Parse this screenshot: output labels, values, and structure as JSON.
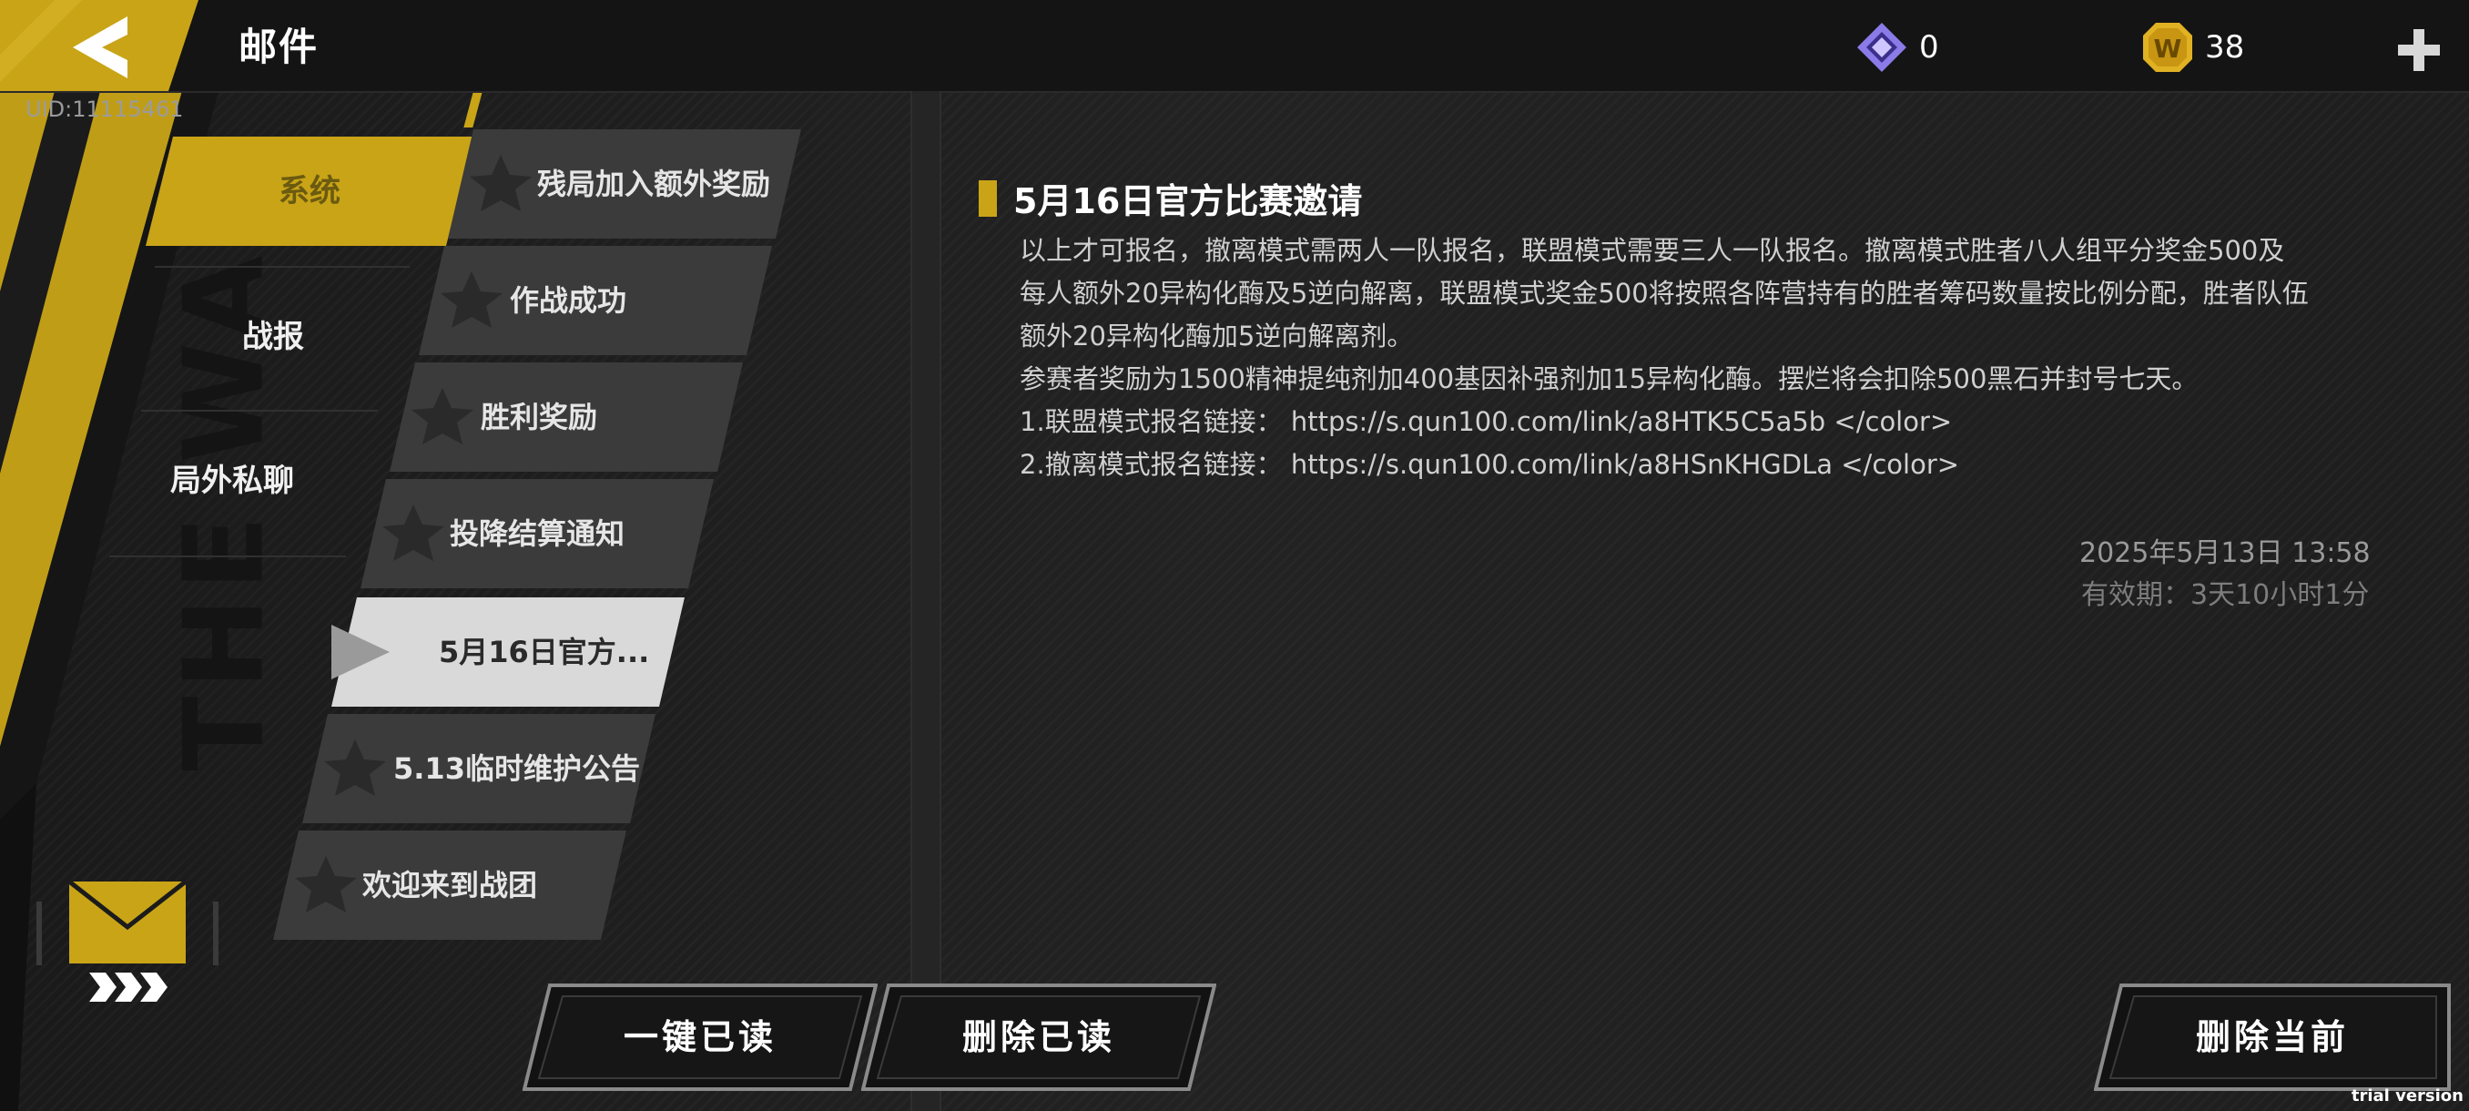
{
  "header": {
    "title": "邮件",
    "uid": "UID:11115461",
    "gem_count": "0",
    "coin_count": "38",
    "coin_letter": "W"
  },
  "deco": {
    "vertical_text": "THE WAR"
  },
  "categories": [
    {
      "label": "系统",
      "active": true
    },
    {
      "label": "战报",
      "active": false
    },
    {
      "label": "局外私聊",
      "active": false
    }
  ],
  "mail_list": [
    {
      "label": "残局加入额外奖励"
    },
    {
      "label": "作战成功"
    },
    {
      "label": "胜利奖励"
    },
    {
      "label": "投降结算通知"
    },
    {
      "label": "5月16日官方..."
    },
    {
      "label": "5.13临时维护公告"
    },
    {
      "label": "欢迎来到战团"
    }
  ],
  "mail": {
    "title": "5月16日官方比赛邀请",
    "body": [
      "以上才可报名，撤离模式需两人一队报名，联盟模式需要三人一队报名。撤离模式胜者八人组平分奖金500及",
      "每人额外20异构化酶及5逆向解离，联盟模式奖金500将按照各阵营持有的胜者筹码数量按比例分配，胜者队伍",
      "额外20异构化酶加5逆向解离剂。",
      "参赛者奖励为1500精神提纯剂加400基因补强剂加15异构化酶。摆烂将会扣除500黑石并封号七天。",
      "1.联盟模式报名链接：  https://s.qun100.com/link/a8HTK5C5a5b </color>",
      "2.撤离模式报名链接：  https://s.qun100.com/link/a8HSnKHGDLa </color>"
    ],
    "date": "2025年5月13日  13:58",
    "expire": "有效期：3天10小时1分"
  },
  "buttons": {
    "read_all": "一键已读",
    "delete_read": "删除已读",
    "delete_current": "删除当前"
  },
  "watermark": "trial version",
  "colors": {
    "accent": "#c9a417",
    "bg": "#1b1b1b"
  }
}
